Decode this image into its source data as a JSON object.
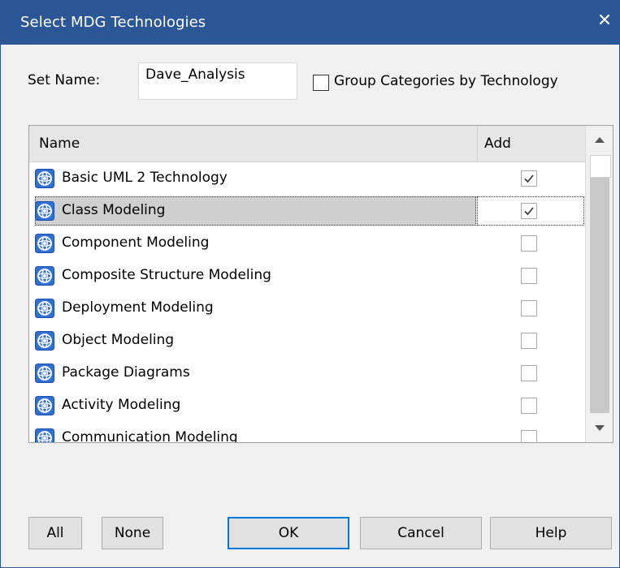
{
  "window": {
    "title": "Select MDG Technologies"
  },
  "form": {
    "set_name_label": "Set Name:",
    "set_name_value": "Dave_Analysis",
    "group_label": "Group Categories by Technology",
    "group_checked": false
  },
  "grid": {
    "headers": {
      "name": "Name",
      "add": "Add"
    },
    "rows": [
      {
        "name": "Basic UML 2 Technology",
        "checked": true,
        "selected": false
      },
      {
        "name": "Class Modeling",
        "checked": true,
        "selected": true
      },
      {
        "name": "Component Modeling",
        "checked": false,
        "selected": false
      },
      {
        "name": "Composite Structure Modeling",
        "checked": false,
        "selected": false
      },
      {
        "name": "Deployment Modeling",
        "checked": false,
        "selected": false
      },
      {
        "name": "Object Modeling",
        "checked": false,
        "selected": false
      },
      {
        "name": "Package Diagrams",
        "checked": false,
        "selected": false
      },
      {
        "name": "Activity Modeling",
        "checked": false,
        "selected": false
      },
      {
        "name": "Communication Modeling",
        "checked": false,
        "selected": false
      }
    ],
    "row_icon": "mdg-technology-icon"
  },
  "buttons": {
    "all": "All",
    "none": "None",
    "ok": "OK",
    "cancel": "Cancel",
    "help": "Help"
  },
  "colors": {
    "title_bar": "#2b5797",
    "primary_border": "#0078d7",
    "selected_row": "#cfcfcf"
  }
}
